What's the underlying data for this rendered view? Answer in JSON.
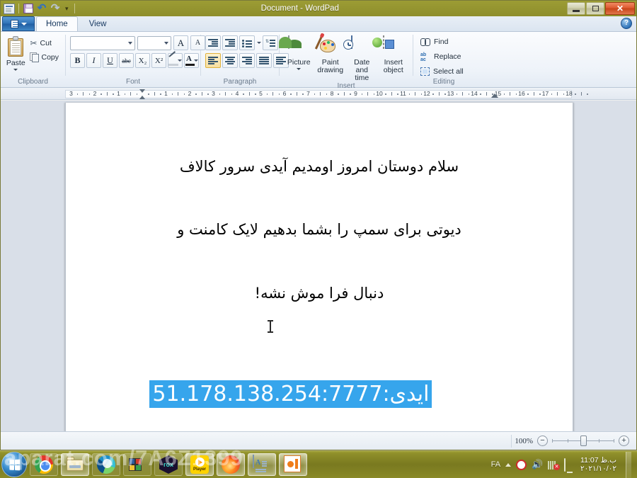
{
  "window": {
    "title": "Document - WordPad",
    "quick_access": [
      "app-menu-icon",
      "save-icon",
      "undo-icon",
      "redo-icon",
      "customize-caret"
    ],
    "controls": {
      "minimize": "–",
      "maximize": "□",
      "close": "✕"
    },
    "help_glyph": "?"
  },
  "tabs": [
    {
      "label": "Home",
      "active": true
    },
    {
      "label": "View",
      "active": false
    }
  ],
  "ribbon": {
    "groups": [
      {
        "name": "Clipboard",
        "label": "Clipboard",
        "paste_label": "Paste",
        "commands": [
          {
            "label": "Cut",
            "icon": "scissors-icon"
          },
          {
            "label": "Copy",
            "icon": "copy-icon"
          }
        ]
      },
      {
        "name": "Font",
        "label": "Font",
        "font_name_value": "",
        "font_name_placeholder": "",
        "font_size_value": "",
        "font_size_placeholder": "",
        "buttons": [
          {
            "name": "grow-font",
            "glyph": "A"
          },
          {
            "name": "shrink-font",
            "glyph": "A"
          },
          {
            "name": "bold",
            "glyph": "B"
          },
          {
            "name": "italic",
            "glyph": "I"
          },
          {
            "name": "underline",
            "glyph": "U"
          },
          {
            "name": "strikethrough",
            "glyph": "abc"
          },
          {
            "name": "subscript",
            "glyph": "X₂"
          },
          {
            "name": "superscript",
            "glyph": "X²"
          },
          {
            "name": "text-highlight",
            "glyph": ""
          },
          {
            "name": "font-color",
            "glyph": "A"
          }
        ]
      },
      {
        "name": "Paragraph",
        "label": "Paragraph",
        "buttons": [
          {
            "name": "decrease-indent"
          },
          {
            "name": "increase-indent"
          },
          {
            "name": "start-bullet-list"
          },
          {
            "name": "line-spacing"
          },
          {
            "name": "align-left",
            "selected": true
          },
          {
            "name": "align-center"
          },
          {
            "name": "align-right"
          },
          {
            "name": "justify"
          },
          {
            "name": "paragraph-settings"
          }
        ]
      },
      {
        "name": "Insert",
        "label": "Insert",
        "commands": [
          {
            "label": "Picture",
            "icon": "picture-icon",
            "has_caret": true
          },
          {
            "label": "Paint\ndrawing",
            "icon": "paint-drawing-icon"
          },
          {
            "label": "Date and\ntime",
            "icon": "date-time-icon"
          },
          {
            "label": "Insert\nobject",
            "icon": "insert-object-icon"
          }
        ]
      },
      {
        "name": "Editing",
        "label": "Editing",
        "commands": [
          {
            "label": "Find",
            "icon": "find-icon"
          },
          {
            "label": "Replace",
            "icon": "replace-icon"
          },
          {
            "label": "Select all",
            "icon": "select-all-icon"
          }
        ]
      }
    ]
  },
  "ruler": {
    "left_labels": [
      "3",
      "2",
      "1"
    ],
    "right_labels": [
      "1",
      "2",
      "3",
      "4",
      "5",
      "6",
      "7",
      "8",
      "9",
      "10",
      "11",
      "12",
      "13",
      "14",
      "15",
      "16",
      "17",
      "18"
    ]
  },
  "document": {
    "paragraph_lines": [
      "سلام دوستان امروز اومدیم آیدی سرور کالاف",
      "دیوتی برای سمپ را بشما بدهیم لایک کامنت و",
      "دنبال فرا موش نشه!"
    ],
    "selected_text": "ایدی:51.178.138.254:7777",
    "selection_color": "#36a5ec",
    "selection_text_color": "#ffffff"
  },
  "statusbar": {
    "zoom_percent": "100%",
    "zoom_out": "−",
    "zoom_in": "+"
  },
  "taskbar": {
    "start": "start-orb",
    "items": [
      {
        "name": "chrome",
        "icon": "chrome-icon",
        "state": "pinned"
      },
      {
        "name": "file-explorer",
        "icon": "folder-icon",
        "state": "active"
      },
      {
        "name": "edge",
        "icon": "edge-icon",
        "state": "pinned"
      },
      {
        "name": "cube-app",
        "icon": "cube-icon",
        "state": "pinned"
      },
      {
        "name": "rox-app",
        "icon": "rox-icon",
        "state": "pinned"
      },
      {
        "name": "player",
        "icon": "player-icon",
        "label": "Player",
        "state": "active"
      },
      {
        "name": "firefox",
        "icon": "firefox-icon",
        "state": "active"
      },
      {
        "name": "wordpad",
        "icon": "wordpad-icon",
        "state": "active"
      },
      {
        "name": "office-app",
        "icon": "orange-office-icon",
        "state": "active"
      }
    ],
    "tray": {
      "language": "FA",
      "icons": [
        "show-hidden-icons-caret",
        "record-icon",
        "volume-icon",
        "network-error-icon",
        "display-icon"
      ],
      "time": "11:07 ب.ظ",
      "date": "۲۰۲۱/۱۰/۰۲"
    }
  },
  "watermark": "aparat.com/7A6Z1399"
}
